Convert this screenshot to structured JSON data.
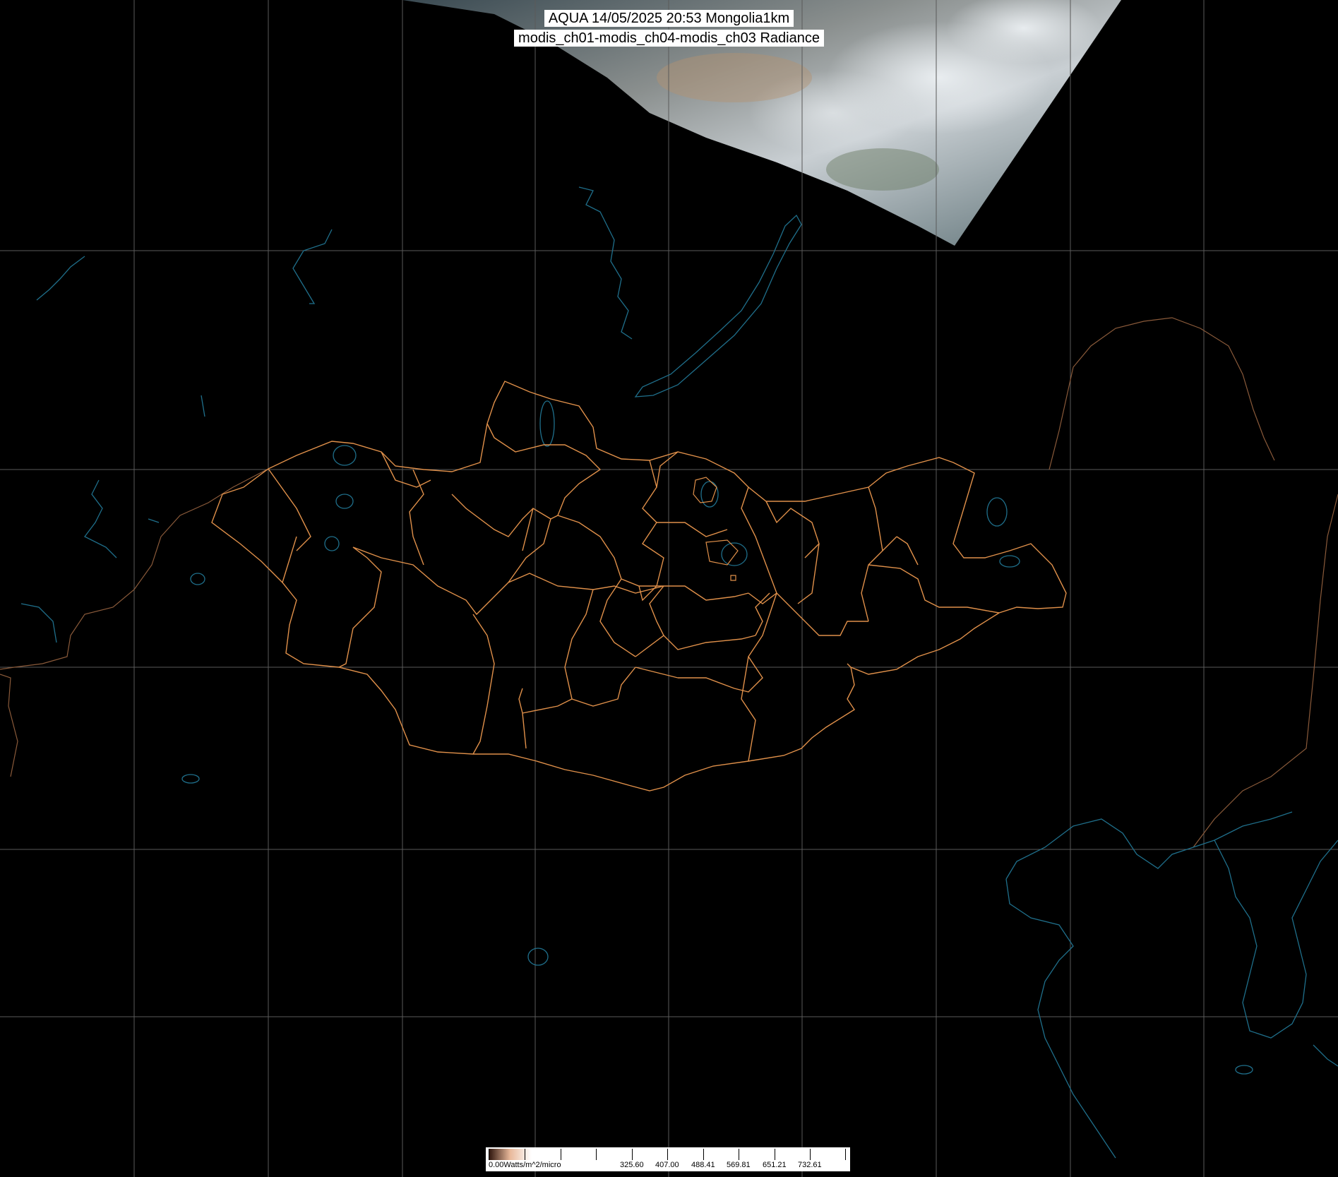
{
  "header": {
    "title": "AQUA 14/05/2025 20:53 Mongolia1km",
    "subtitle": "modis_ch01-modis_ch04-modis_ch03 Radiance"
  },
  "legend": {
    "labels": [
      "0.00Watts/m^2/micro",
      "325.60",
      "407.00",
      "488.41",
      "569.81",
      "651.21",
      "732.61"
    ],
    "colors": [
      "#2a120a",
      "#e8b89a",
      "#ffffff"
    ]
  },
  "map": {
    "background_color": "#000000",
    "grid_color": "#5a5a5a",
    "coastline_color": "#1f6f8b",
    "province_border_color": "#e0904a",
    "country_border_color": "#8a5a3a",
    "satellite_swath": "cloud imagery"
  }
}
